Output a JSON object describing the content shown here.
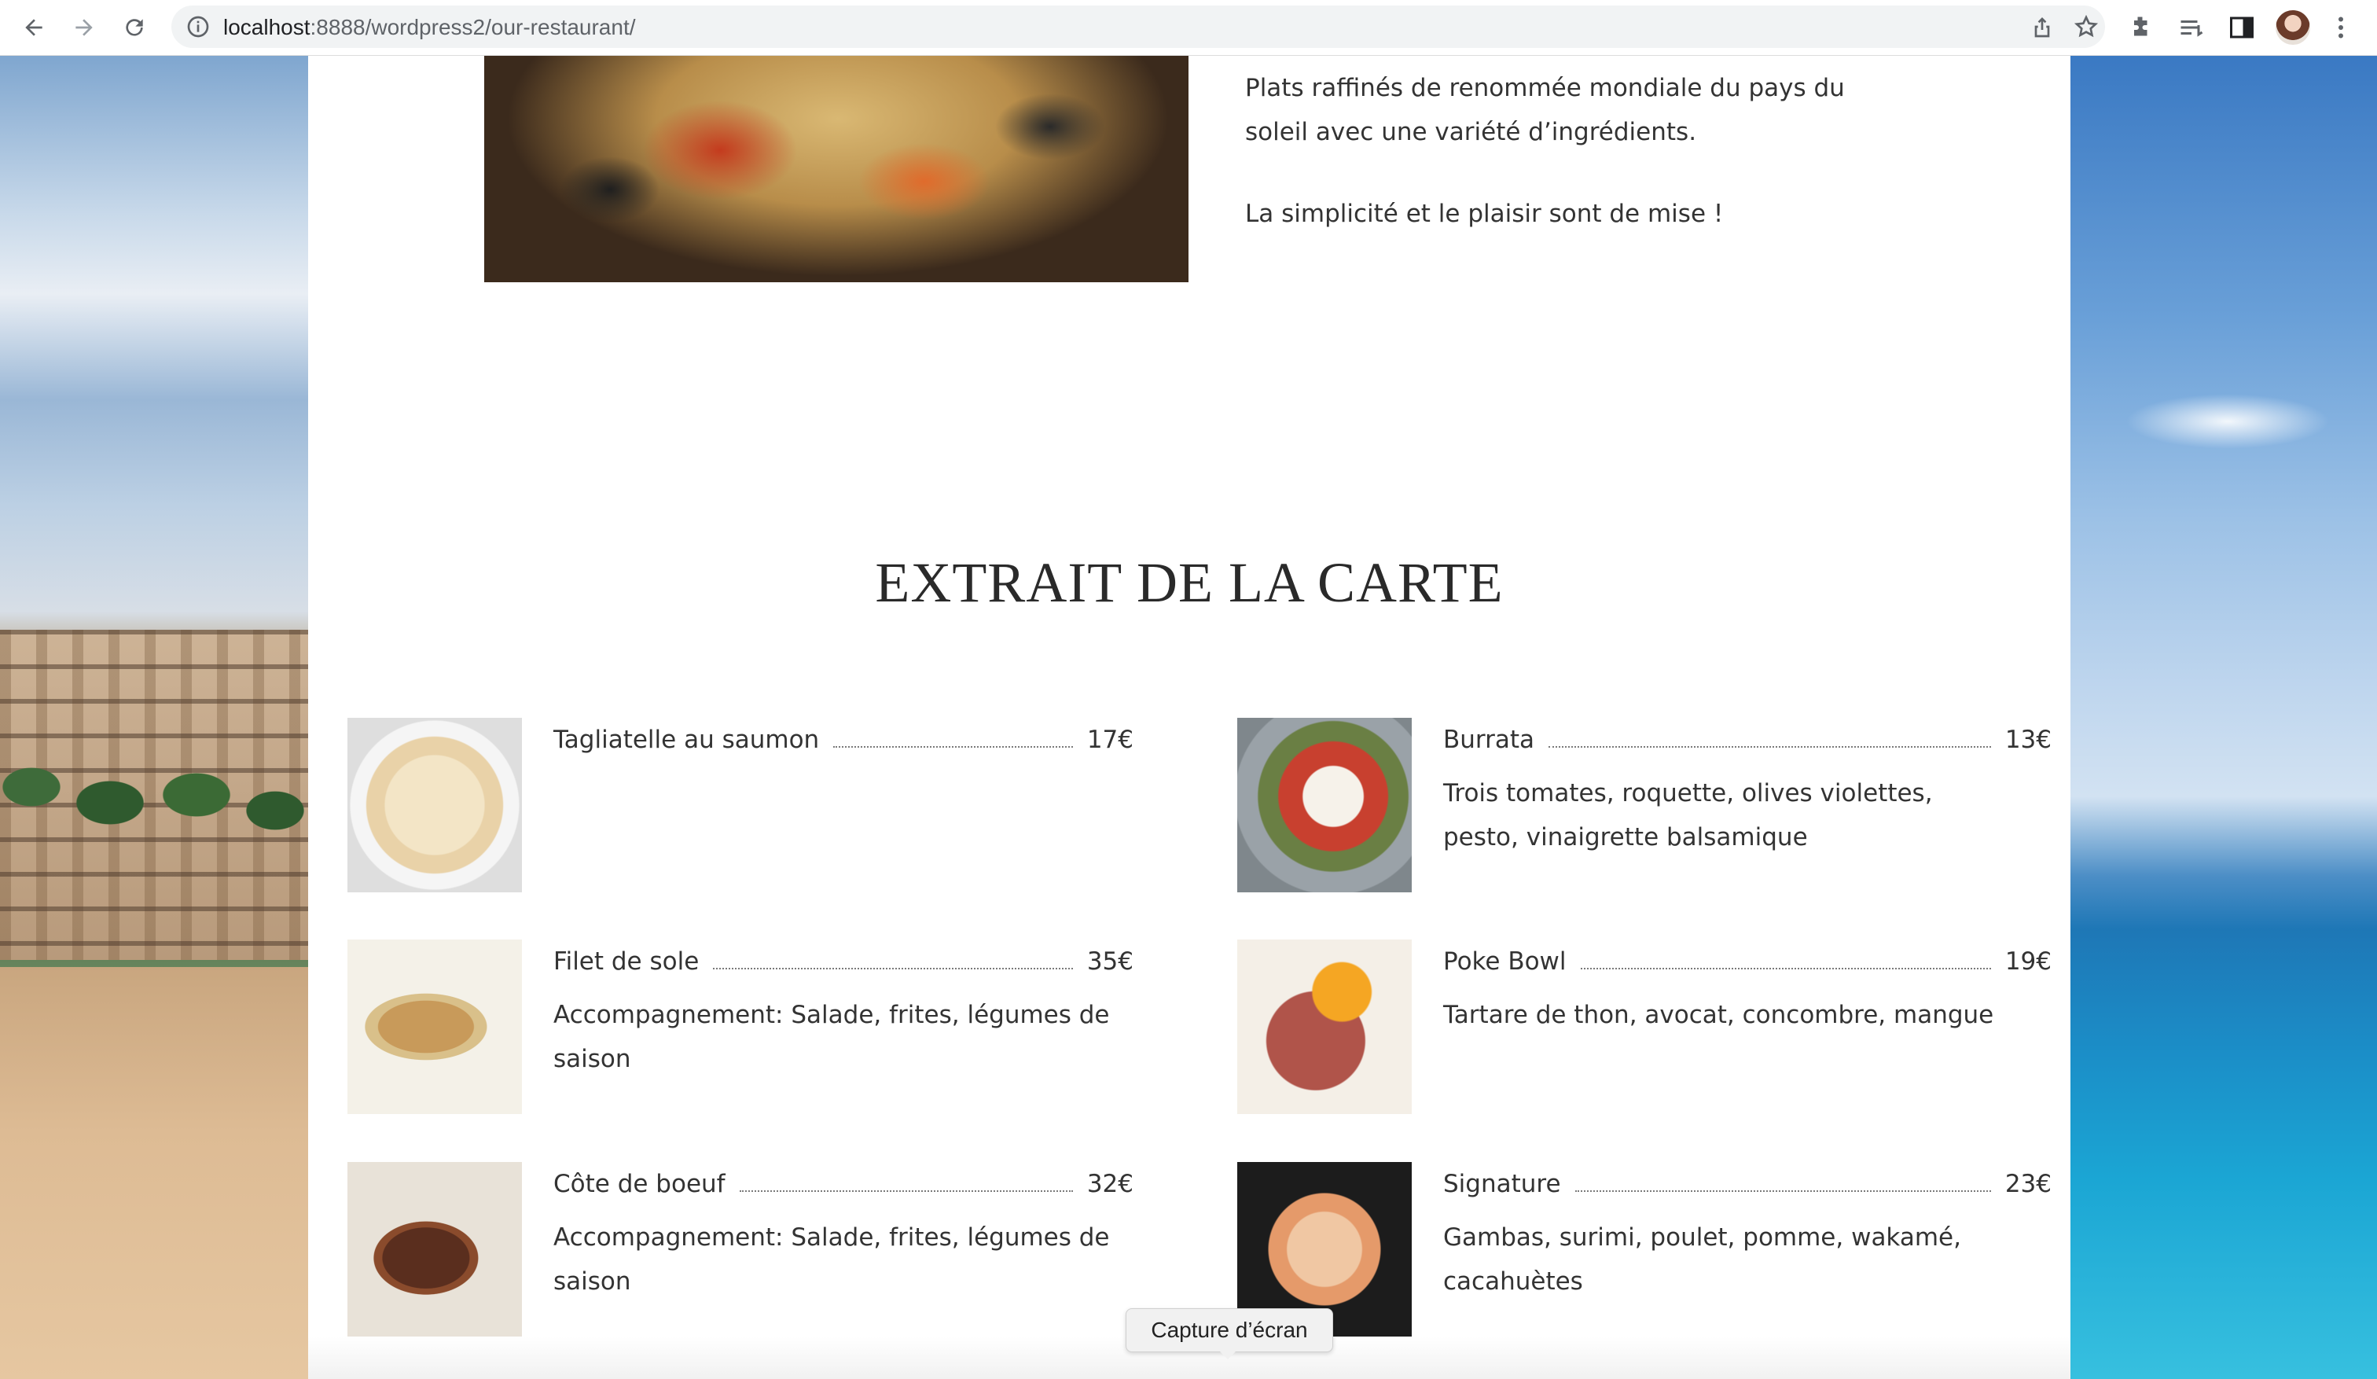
{
  "browser": {
    "url_host": "localhost",
    "url_path": ":8888/wordpress2/our-restaurant/",
    "icons": [
      "back-icon",
      "forward-icon",
      "reload-icon",
      "site-info-icon",
      "share-icon",
      "bookmark-star-icon",
      "extensions-icon",
      "reading-list-icon",
      "side-panel-icon",
      "profile-avatar",
      "more-menu-icon"
    ]
  },
  "intro": {
    "paragraph1": "Plats raffinés de renommée mondiale du pays du soleil avec une variété d’ingrédients.",
    "paragraph2": "La simplicité et le plaisir sont de mise !"
  },
  "menu": {
    "title": "EXTRAIT DE LA CARTE",
    "items": [
      {
        "name": "Tagliatelle au saumon",
        "price": "17€",
        "description": ""
      },
      {
        "name": "Burrata",
        "price": "13€",
        "description": "Trois tomates, roquette, olives violettes, pesto, vinaigrette balsamique"
      },
      {
        "name": "Filet de sole",
        "price": "35€",
        "description": "Accompagnement: Salade, frites, légumes de saison"
      },
      {
        "name": "Poke Bowl",
        "price": "19€",
        "description": "Tartare de thon, avocat, concombre, mangue"
      },
      {
        "name": "Côte de boeuf",
        "price": "32€",
        "description": "Accompagnement: Salade, frites, légumes de saison"
      },
      {
        "name": "Signature",
        "price": "23€",
        "description": "Gambas, surimi, poulet, pomme, wakamé, cacahuètes"
      }
    ]
  },
  "tooltip": {
    "text": "Capture d’écran"
  },
  "colors": {
    "text": "#333333",
    "title": "#2a2a2a",
    "chrome_bg": "#ffffff",
    "omnibox_bg": "#f1f3f4"
  }
}
